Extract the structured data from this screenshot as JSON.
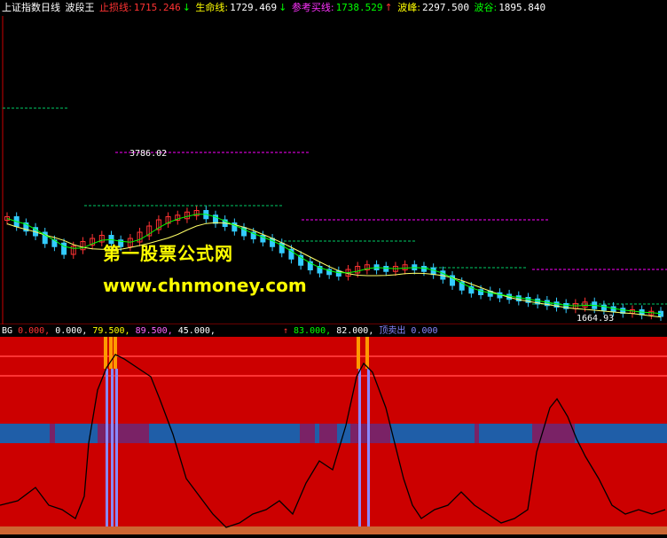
{
  "header": {
    "index_name": "上证指数日线",
    "indicator_name": "波段王",
    "stop_loss_label": "止损线:",
    "stop_loss_value": "1715.246",
    "stop_loss_arrow": "↓",
    "life_line_label": "生命线:",
    "life_line_value": "1729.469",
    "life_line_arrow": "↓",
    "buy_line_label": "参考买线:",
    "buy_line_value": "1738.529",
    "buy_line_arrow": "↑",
    "peak_label": "波峰:",
    "peak_value": "2297.500",
    "trough_label": "波谷:",
    "trough_value": "1895.840"
  },
  "chart_labels": {
    "high_marker": "3786.02",
    "low_marker": "1664.93"
  },
  "watermark": {
    "line1": "第一股票公式网",
    "line2": "www.chnmoney.com"
  },
  "indicator_header": {
    "name": "BG",
    "v1": "0.000,",
    "v2": "0.000,",
    "v3": "79.500,",
    "v4": "89.500,",
    "v5": "45.000,",
    "arrow": "↑",
    "v6": "83.000,",
    "v7": "82.000,",
    "v8_label": "顶卖出",
    "v9": "0.000"
  },
  "colors": {
    "background": "#000000",
    "candle_up": "#ff3333",
    "candle_down": "#33ccff",
    "ma_short": "#00ff00",
    "ma_long": "#ffff66",
    "dash_magenta": "#ff00ff",
    "dash_green": "#00cc66",
    "ind_red": "#cc0000",
    "ind_blue": "#1f5ea8",
    "ind_purple": "#7a2266",
    "ind_orange": "#ff9900",
    "ind_line": "#000000"
  },
  "chart_data": {
    "type": "candlestick",
    "series": [
      {
        "name": "",
        "values": [
          0.62,
          0.58,
          0.55,
          0.52,
          0.47,
          0.45,
          0.4,
          0.43,
          0.46,
          0.48,
          0.5,
          0.47,
          0.45,
          0.48,
          0.52,
          0.56,
          0.6,
          0.62,
          0.63,
          0.65,
          0.66,
          0.63,
          0.6,
          0.58,
          0.55,
          0.52,
          0.5,
          0.48,
          0.45,
          0.41,
          0.37,
          0.33,
          0.3,
          0.28,
          0.27,
          0.26,
          0.28,
          0.3,
          0.31,
          0.3,
          0.29,
          0.3,
          0.31,
          0.3,
          0.29,
          0.27,
          0.24,
          0.2,
          0.17,
          0.15,
          0.14,
          0.13,
          0.12,
          0.11,
          0.1,
          0.09,
          0.08,
          0.07,
          0.06,
          0.05,
          0.06,
          0.07,
          0.05,
          0.04,
          0.03,
          0.02,
          0.02,
          0.01,
          0.01,
          0.0
        ]
      }
    ]
  }
}
